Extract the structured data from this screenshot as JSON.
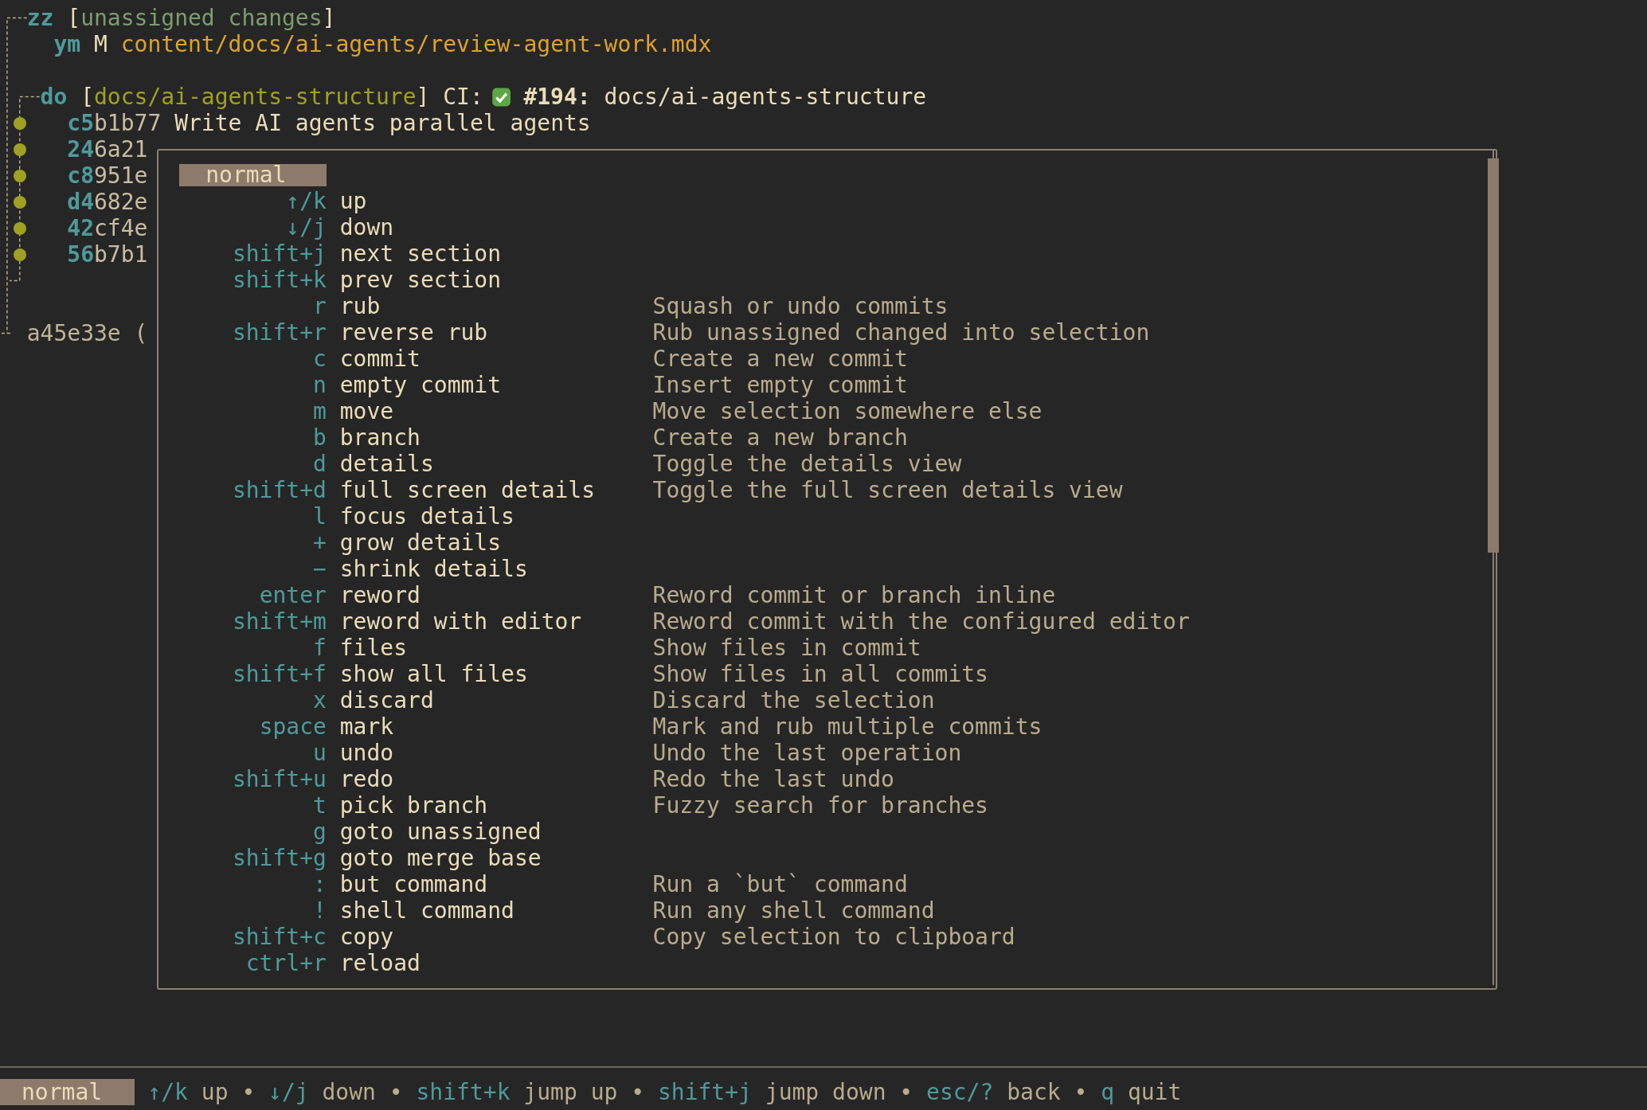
{
  "graph": {
    "unassigned": {
      "id": "zz",
      "open": "[",
      "label": "unassigned changes",
      "close": "]",
      "files": [
        {
          "id": "ym",
          "status": "M",
          "path": "content/docs/ai-agents/review-agent-work.mdx"
        }
      ]
    },
    "branch": {
      "id": "do",
      "open": "[",
      "name": "docs/ai-agents-structure",
      "close": "]",
      "ci_label": "CI:",
      "pr_number": "#194:",
      "pr_title": "docs/ai-agents-structure",
      "commits": [
        {
          "prefix": "c5",
          "rest": "b1b77",
          "message": "Write AI agents parallel agents"
        },
        {
          "prefix": "24",
          "rest": "6a21"
        },
        {
          "prefix": "c8",
          "rest": "951e"
        },
        {
          "prefix": "d4",
          "rest": "682e"
        },
        {
          "prefix": "42",
          "rest": "cf4e"
        },
        {
          "prefix": "56",
          "rest": "b7b1"
        }
      ]
    },
    "base": "a45e33e ("
  },
  "help": {
    "mode": "normal",
    "bindings": [
      {
        "key": "↑/k",
        "action": "up"
      },
      {
        "key": "↓/j",
        "action": "down"
      },
      {
        "key": "shift+j",
        "action": "next section"
      },
      {
        "key": "shift+k",
        "action": "prev section"
      },
      {
        "key": "r",
        "action": "rub",
        "description": "Squash or undo commits"
      },
      {
        "key": "shift+r",
        "action": "reverse rub",
        "description": "Rub unassigned changed into selection"
      },
      {
        "key": "c",
        "action": "commit",
        "description": "Create a new commit"
      },
      {
        "key": "n",
        "action": "empty commit",
        "description": "Insert empty commit"
      },
      {
        "key": "m",
        "action": "move",
        "description": "Move selection somewhere else"
      },
      {
        "key": "b",
        "action": "branch",
        "description": "Create a new branch"
      },
      {
        "key": "d",
        "action": "details",
        "description": "Toggle the details view"
      },
      {
        "key": "shift+d",
        "action": "full screen details",
        "description": "Toggle the full screen details view"
      },
      {
        "key": "l",
        "action": "focus details"
      },
      {
        "key": "+",
        "action": "grow details"
      },
      {
        "key": "−",
        "action": "shrink details"
      },
      {
        "key": "enter",
        "action": "reword",
        "description": "Reword commit or branch inline"
      },
      {
        "key": "shift+m",
        "action": "reword with editor",
        "description": "Reword commit with the configured editor"
      },
      {
        "key": "f",
        "action": "files",
        "description": "Show files in commit"
      },
      {
        "key": "shift+f",
        "action": "show all files",
        "description": "Show files in all commits"
      },
      {
        "key": "x",
        "action": "discard",
        "description": "Discard the selection"
      },
      {
        "key": "space",
        "action": "mark",
        "description": "Mark and rub multiple commits"
      },
      {
        "key": "u",
        "action": "undo",
        "description": "Undo the last operation"
      },
      {
        "key": "shift+u",
        "action": "redo",
        "description": "Redo the last undo"
      },
      {
        "key": "t",
        "action": "pick branch",
        "description": "Fuzzy search for branches"
      },
      {
        "key": "g",
        "action": "goto unassigned"
      },
      {
        "key": "shift+g",
        "action": "goto merge base"
      },
      {
        "key": ":",
        "action": "but command",
        "description": "Run a `but` command"
      },
      {
        "key": "!",
        "action": "shell command",
        "description": "Run any shell command"
      },
      {
        "key": "shift+c",
        "action": "copy",
        "description": "Copy selection to clipboard"
      },
      {
        "key": "ctrl+r",
        "action": "reload"
      }
    ]
  },
  "status_bar": {
    "mode": "normal",
    "hints": [
      {
        "key": "↑/k",
        "action": "up",
        "separator": "•"
      },
      {
        "key": "↓/j",
        "action": "down",
        "separator": "•"
      },
      {
        "key": "shift+k",
        "action": "jump up",
        "separator": "•"
      },
      {
        "key": "shift+j",
        "action": "jump down",
        "separator": "•"
      },
      {
        "key": "esc/?",
        "action": "back",
        "separator": "•"
      },
      {
        "key": "q",
        "action": "quit"
      }
    ]
  }
}
